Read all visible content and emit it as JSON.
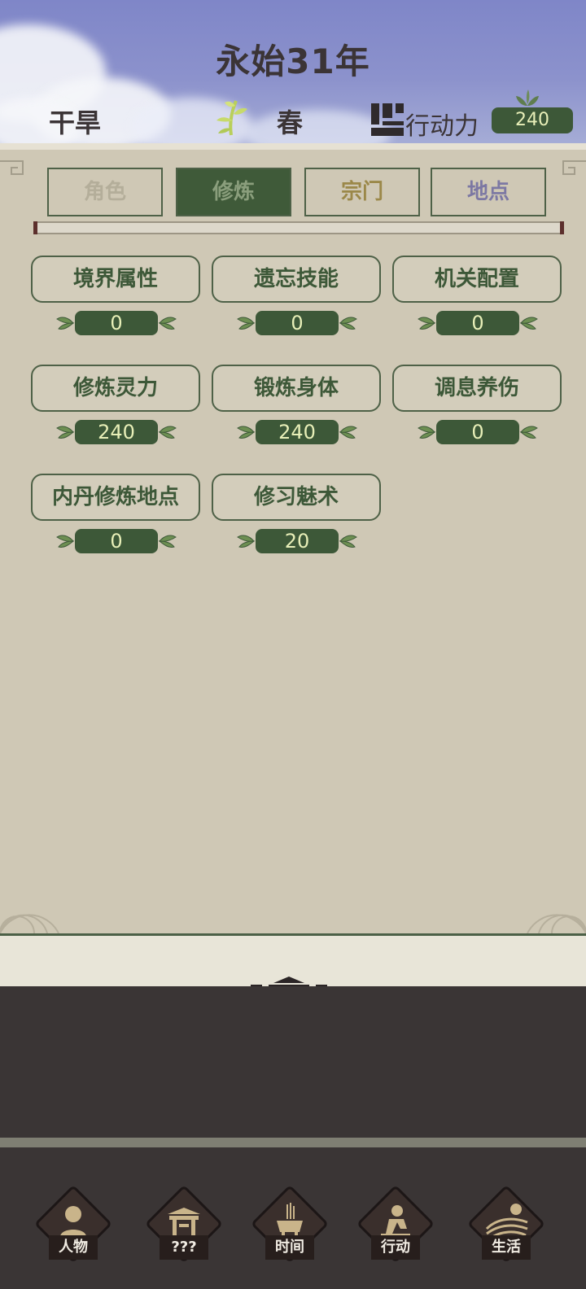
{
  "header": {
    "year": "永始31年",
    "weather": "干旱",
    "season": "春",
    "action_points_label": "行动力",
    "action_points_value": "240"
  },
  "tabs": [
    {
      "label": "角色",
      "state": "inactive"
    },
    {
      "label": "修炼",
      "state": "selected"
    },
    {
      "label": "宗门",
      "state": "inactive"
    },
    {
      "label": "地点",
      "state": "inactive"
    }
  ],
  "skills": [
    {
      "label": "境界属性",
      "value": "0"
    },
    {
      "label": "遗忘技能",
      "value": "0"
    },
    {
      "label": "机关配置",
      "value": "0"
    },
    {
      "label": "修炼灵力",
      "value": "240"
    },
    {
      "label": "锻炼身体",
      "value": "240"
    },
    {
      "label": "调息养伤",
      "value": "0"
    },
    {
      "label": "内丹修炼地点",
      "value": "0"
    },
    {
      "label": "修习魅术",
      "value": "20"
    }
  ],
  "bottom_nav": [
    {
      "label": "人物",
      "icon": "person-icon"
    },
    {
      "label": "???",
      "icon": "gate-icon"
    },
    {
      "label": "时间",
      "icon": "incense-icon"
    },
    {
      "label": "行动",
      "icon": "action-icon"
    },
    {
      "label": "生活",
      "icon": "field-icon"
    }
  ],
  "colors": {
    "sky": "#8c92cc",
    "panel": "#cfc8b5",
    "accent_green": "#3d5838",
    "value_text": "#e8efb8",
    "dark_bg": "#3a3535"
  }
}
